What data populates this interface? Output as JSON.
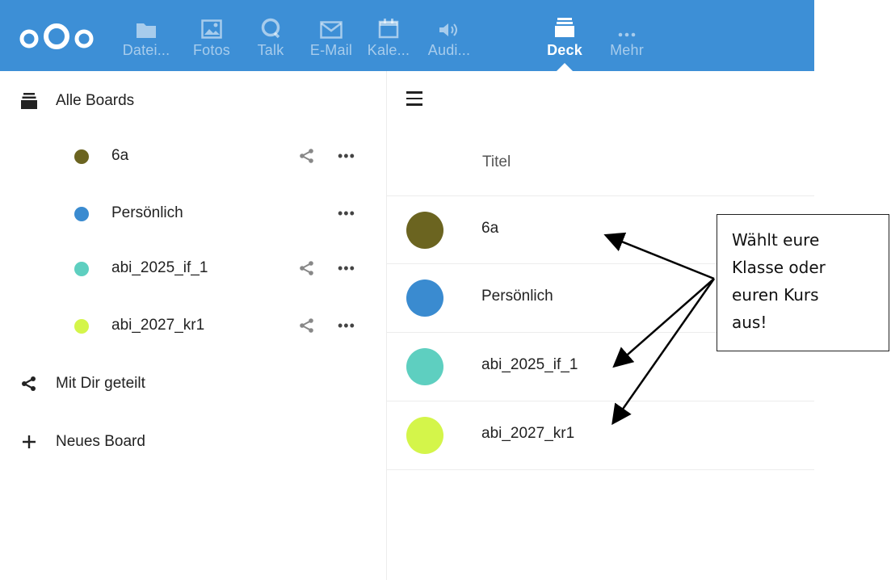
{
  "topbar": {
    "apps": [
      {
        "label": "Datei...",
        "icon": "folder-icon"
      },
      {
        "label": "Fotos",
        "icon": "image-icon"
      },
      {
        "label": "Talk",
        "icon": "talk-icon"
      },
      {
        "label": "E-Mail",
        "icon": "mail-icon"
      },
      {
        "label": "Kale...",
        "icon": "calendar-icon"
      },
      {
        "label": "Audi...",
        "icon": "speaker-icon"
      },
      {
        "label": "Deck",
        "icon": "deck-icon",
        "active": true
      },
      {
        "label": "Mehr",
        "icon": "more-icon"
      }
    ],
    "color": "#3d8fd6"
  },
  "sidebar": {
    "all_boards": "Alle Boards",
    "boards": [
      {
        "label": "6a",
        "color": "#6b6420",
        "shared": true
      },
      {
        "label": "Persönlich",
        "color": "#3a8bd0",
        "shared": false
      },
      {
        "label": "abi_2025_if_1",
        "color": "#5ecfc0",
        "shared": true
      },
      {
        "label": "abi_2027_kr1",
        "color": "#d4f54a",
        "shared": true
      }
    ],
    "shared_with_you": "Mit Dir geteilt",
    "new_board": "Neues Board"
  },
  "main": {
    "column_title": "Titel",
    "rows": [
      {
        "label": "6a",
        "color": "#6b6420"
      },
      {
        "label": "Persönlich",
        "color": "#3a8bd0"
      },
      {
        "label": "abi_2025_if_1",
        "color": "#5ecfc0"
      },
      {
        "label": "abi_2027_kr1",
        "color": "#d4f54a"
      }
    ]
  },
  "callout": {
    "lines": [
      "Wählt eure",
      "Klasse oder",
      "euren Kurs",
      "aus!"
    ]
  }
}
